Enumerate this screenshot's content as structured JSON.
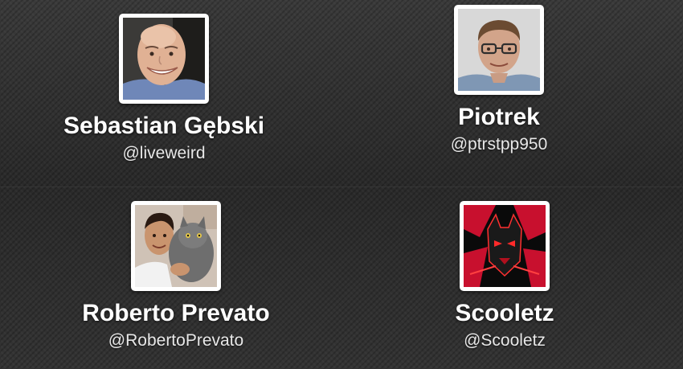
{
  "users": [
    {
      "name": "Sebastian Gębski",
      "handle": "@liveweird",
      "avatar": "bald-smiling-man-photo"
    },
    {
      "name": "Piotrek",
      "handle": "@ptrstpp950",
      "avatar": "man-with-glasses-photo"
    },
    {
      "name": "Roberto Prevato",
      "handle": "@RobertoPrevato",
      "avatar": "man-holding-cat-photo"
    },
    {
      "name": "Scooletz",
      "handle": "@Scooletz",
      "avatar": "red-black-superhero-artwork"
    }
  ]
}
